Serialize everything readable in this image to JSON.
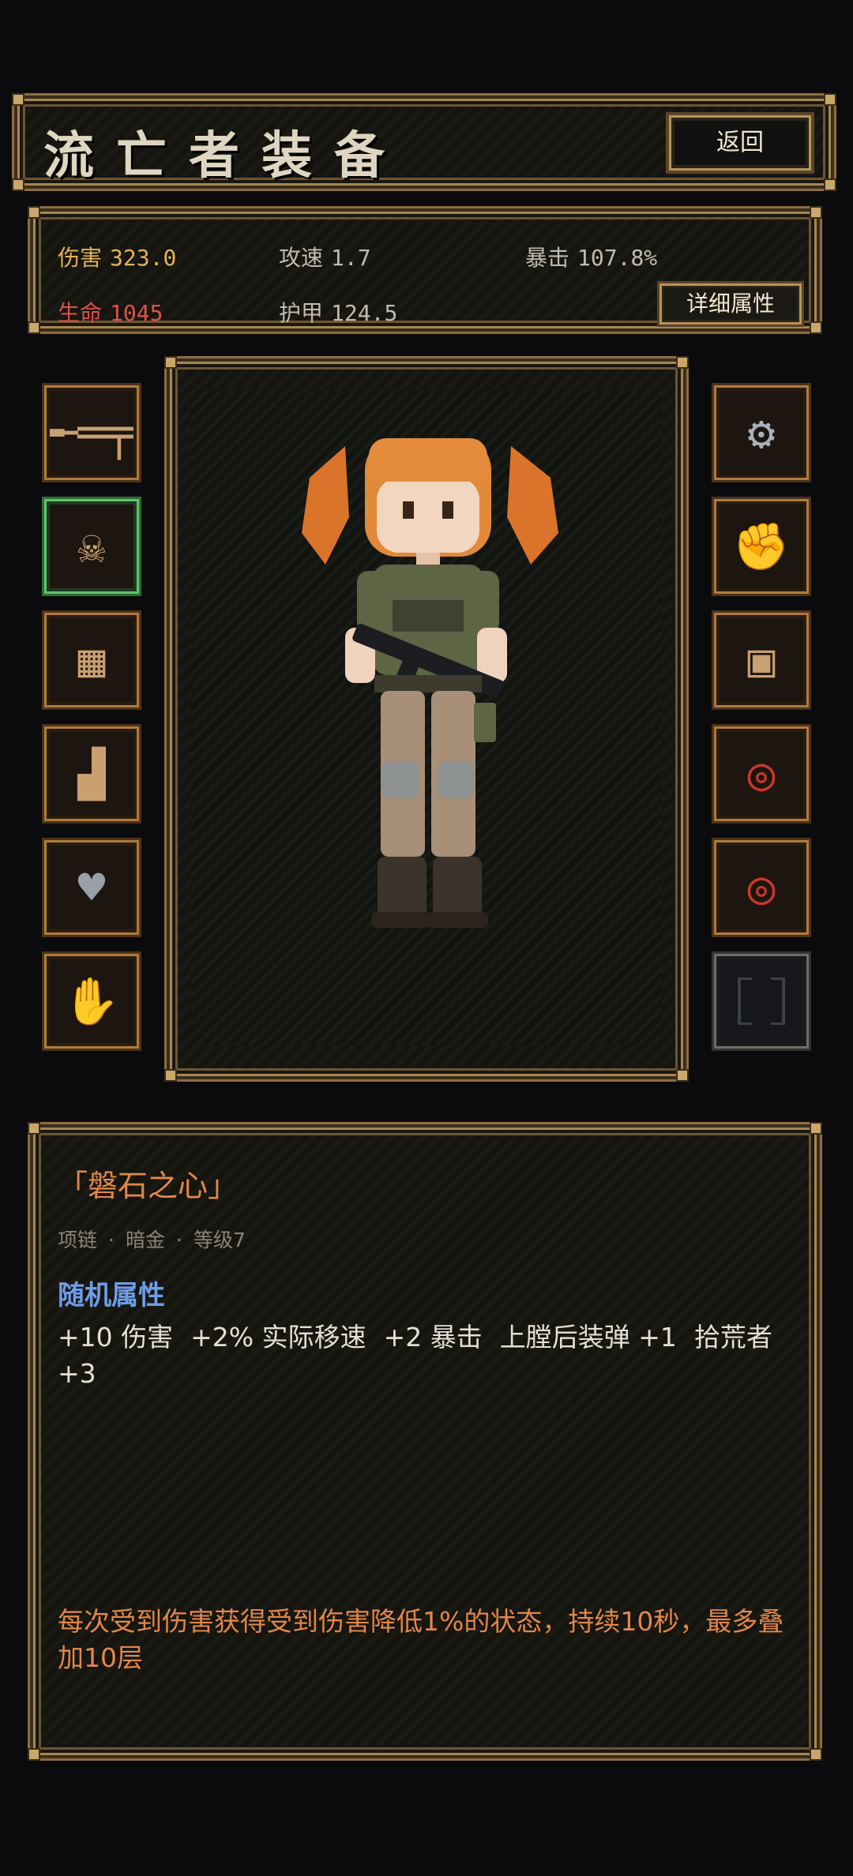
{
  "header": {
    "title": "流亡者装备",
    "back_label": "返回"
  },
  "stats": {
    "damage": {
      "label": "伤害",
      "value": "323.0"
    },
    "attack_speed": {
      "label": "攻速",
      "value": "1.7"
    },
    "crit": {
      "label": "暴击",
      "value": "107.8%"
    },
    "life": {
      "label": "生命",
      "value": "1045"
    },
    "armor": {
      "label": "护甲",
      "value": "124.5"
    },
    "detail_label": "详细属性"
  },
  "slots": {
    "left": [
      {
        "icon": "rifle-icon",
        "selected": false
      },
      {
        "icon": "skull-mask-icon",
        "selected": true
      },
      {
        "icon": "armor-vest-icon",
        "selected": false
      },
      {
        "icon": "boots-icon",
        "selected": false
      },
      {
        "icon": "heart-necklace-icon",
        "selected": false
      },
      {
        "icon": "bone-hand-charm-icon",
        "selected": false
      }
    ],
    "right": [
      {
        "icon": "gear-module-icon"
      },
      {
        "icon": "gauntlet-icon"
      },
      {
        "icon": "ornate-frame-icon"
      },
      {
        "icon": "red-ring-icon"
      },
      {
        "icon": "red-ring-icon"
      },
      {
        "icon": "empty-slot-icon"
      }
    ]
  },
  "item": {
    "name": "「磐石之心」",
    "meta": [
      "项链",
      "暗金",
      "等级7"
    ],
    "random_title": "随机属性",
    "random_props": [
      "+10 伤害",
      "+2% 实际移速",
      "+2 暴击",
      "上膛后装弹 +1",
      "拾荒者 +3"
    ],
    "effect": "每次受到伤害获得受到伤害降低1%的状态，持续10秒，最多叠加10层"
  },
  "colors": {
    "frame": "#a88652",
    "gold_text": "#e2b25a",
    "red_text": "#e0514a",
    "item_name": "#e2874a",
    "random_title": "#6f9de8",
    "selected_slot": "#5fc46a"
  }
}
